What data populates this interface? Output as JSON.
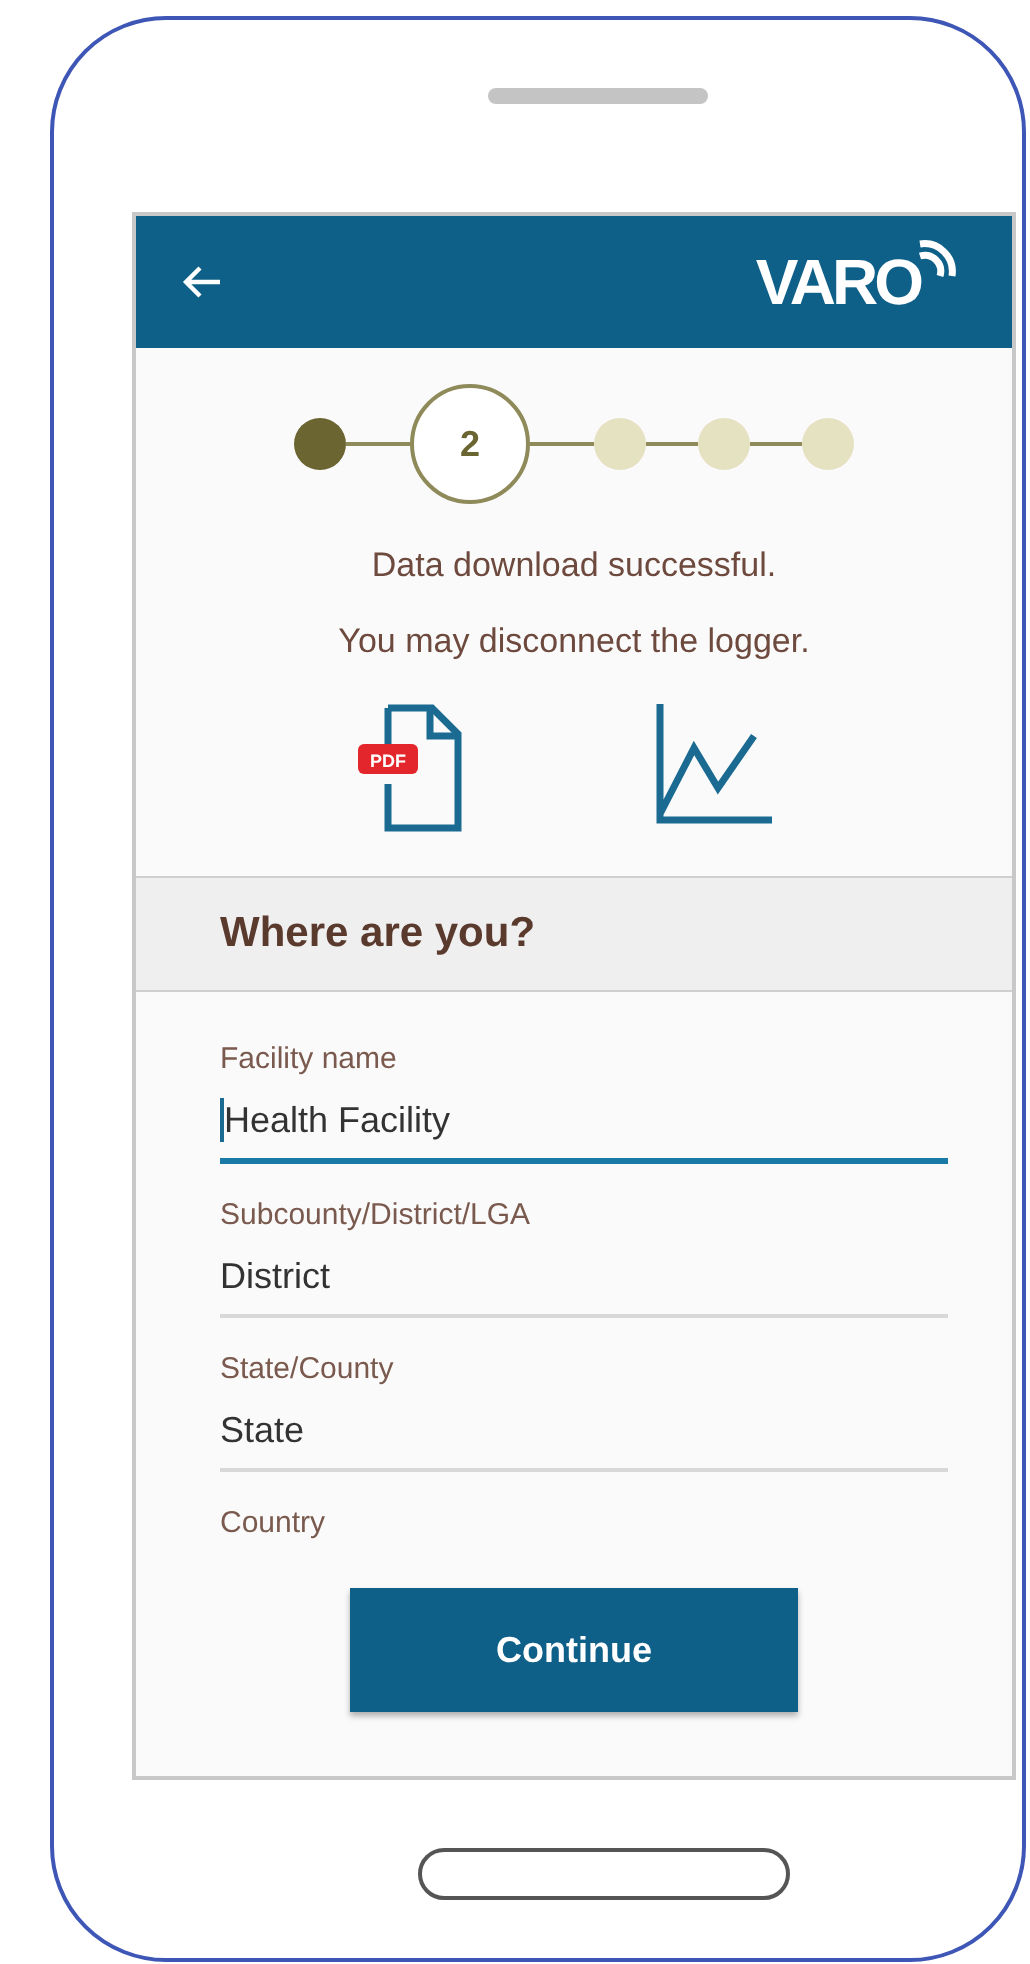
{
  "header": {
    "logo": "VARO"
  },
  "stepper": [
    {
      "kind": "done"
    },
    {
      "kind": "current",
      "label": "2"
    },
    {
      "kind": "pending"
    },
    {
      "kind": "pending"
    },
    {
      "kind": "pending"
    }
  ],
  "messages": [
    "Data download successful.",
    "You may disconnect the logger."
  ],
  "pdf_badge": "PDF",
  "section_title": "Where are you?",
  "fields": [
    {
      "label": "Facility name",
      "value": "Health Facility",
      "focused": true
    },
    {
      "label": "Subcounty/District/LGA",
      "value": "District",
      "focused": false
    },
    {
      "label": "State/County",
      "value": "State",
      "focused": false
    },
    {
      "label": "Country"
    }
  ],
  "button": "Continue"
}
